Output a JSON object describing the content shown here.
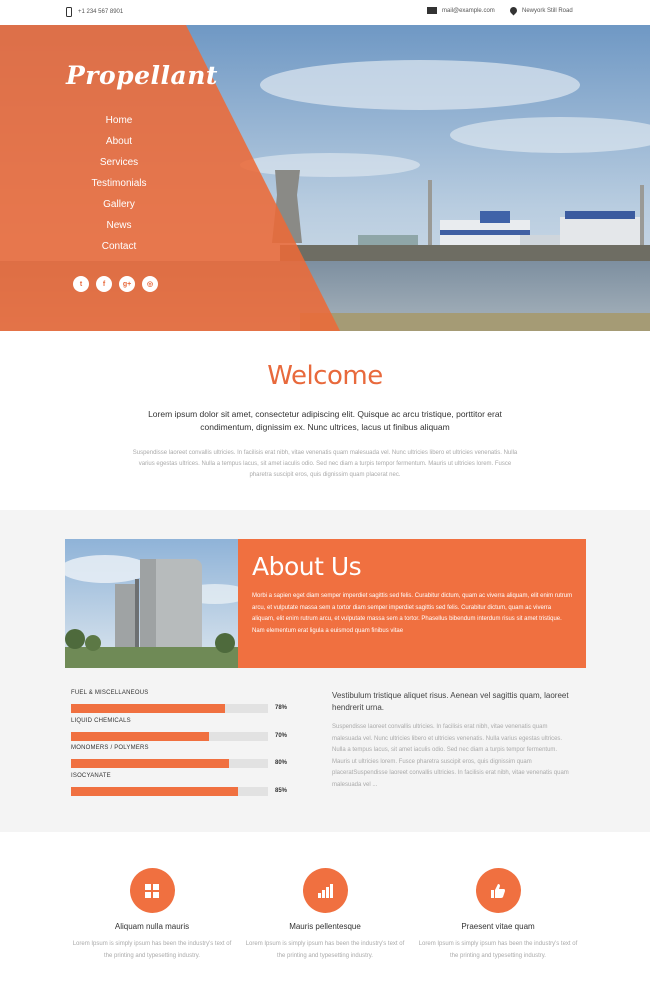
{
  "topbar": {
    "phone": "+1 234 567 8901",
    "email": "mail@example.com",
    "address": "Newyork Still Road"
  },
  "hero": {
    "brand": "Propellant",
    "nav": [
      "Home",
      "About",
      "Services",
      "Testimonials",
      "Gallery",
      "News",
      "Contact"
    ],
    "socials": [
      {
        "icon": "twitter-icon",
        "glyph": "t"
      },
      {
        "icon": "facebook-icon",
        "glyph": "f"
      },
      {
        "icon": "google-plus-icon",
        "glyph": "g+"
      },
      {
        "icon": "dribbble-icon",
        "glyph": "◎"
      }
    ]
  },
  "welcome": {
    "title": "Welcome",
    "lead": "Lorem ipsum dolor sit amet, consectetur adipiscing elit. Quisque ac arcu tristique, porttitor erat condimentum, dignissim ex. Nunc ultrices, lacus ut finibus aliquam",
    "body": "Suspendisse laoreet convallis ultricies. In facilisis erat nibh, vitae venenatis quam malesuada vel. Nunc ultricies libero et ultricies venenatis. Nulla varius egestas ultrices. Nulla a tempus lacus, sit amet iaculis odio. Sed nec diam a turpis tempor fermentum. Mauris ut ultricies lorem. Fusce pharetra suscipit eros, quis dignissim quam placerat nec."
  },
  "about": {
    "title": "About Us",
    "text": "Morbi a sapien eget diam semper imperdiet sagittis sed felis. Curabitur dictum, quam ac viverra aliquam, elit enim rutrum arcu, et vulputate massa sem a tortor diam semper imperdiet sagittis sed felis. Curabitur dictum, quam ac viverra aliquam, elit enim rutrum arcu, et vulputate massa sem a tortor. Phasellus bibendum interdum risus sit amet tristique. Nam elementum erat ligula a euismod quam finibus vitae",
    "bars": [
      {
        "label": "FUEL & MISCELLANEOUS",
        "value": 78,
        "display": "78%"
      },
      {
        "label": "LIQUID CHEMICALS",
        "value": 70,
        "display": "70%"
      },
      {
        "label": "MONOMERS / POLYMERS",
        "value": 80,
        "display": "80%"
      },
      {
        "label": "ISOCYANATE",
        "value": 85,
        "display": "85%"
      }
    ],
    "side_title": "Vestibulum tristique aliquet risus. Aenean vel sagittis quam, laoreet hendrerit urna.",
    "side_text": "Suspendisse laoreet convallis ultricies. In facilisis erat nibh, vitae venenatis quam malesuada vel. Nunc ultricies libero et ultricies venenatis. Nulla varius egestas ultrices. Nulla a tempus lacus, sit amet iaculis odio. Sed nec diam a turpis tempor fermentum. Mauris ut ultricies lorem. Fusce pharetra suscipit eros, quis dignissim quam placeratSuspendisse laoreet convallis ultricies. In facilisis erat nibh, vitae venenatis quam malesuada vel ..."
  },
  "features": [
    {
      "icon": "grid-icon",
      "title": "Aliquam nulla mauris",
      "text": "Lorem Ipsum is simply ipsum has been the industry's text of the printing and typesetting industry."
    },
    {
      "icon": "bar-chart-icon",
      "title": "Mauris pellentesque",
      "text": "Lorem Ipsum is simply ipsum has been the industry's text of the printing and typesetting industry."
    },
    {
      "icon": "thumbs-up-icon",
      "title": "Praesent vitae quam",
      "text": "Lorem Ipsum is simply ipsum has been the industry's text of the printing and typesetting industry."
    }
  ],
  "colors": {
    "accent": "#f07040",
    "accent_dark": "#e8693c"
  }
}
